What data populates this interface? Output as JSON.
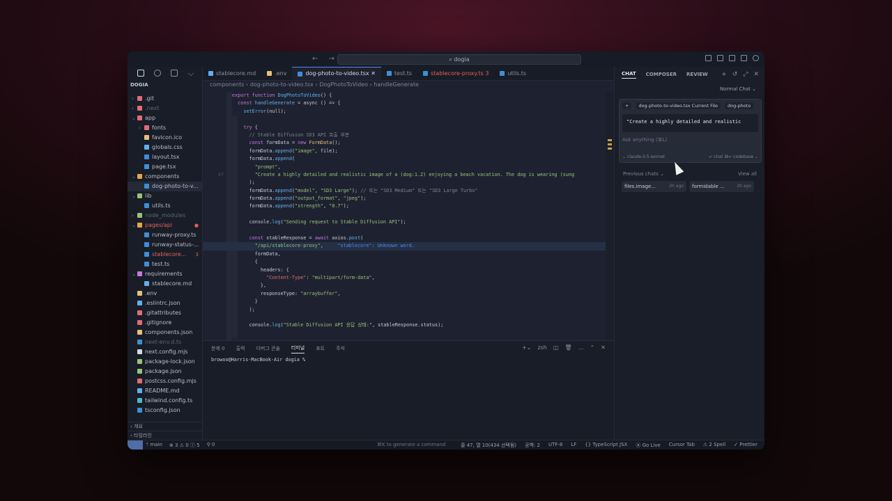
{
  "titlebar": {
    "search": "dogia"
  },
  "sidebar": {
    "project": "DOGIA",
    "tree": [
      {
        "label": ".git",
        "chev": "›",
        "indent": 1,
        "color": "#e06c75",
        "cls": ""
      },
      {
        "label": ".next",
        "chev": "›",
        "indent": 1,
        "color": "#e06c75",
        "cls": "dim"
      },
      {
        "label": "app",
        "chev": "⌄",
        "indent": 1,
        "color": "#e06c75",
        "cls": ""
      },
      {
        "label": "fonts",
        "chev": "›",
        "indent": 2,
        "color": "#e06c75",
        "cls": ""
      },
      {
        "label": "favicon.ico",
        "chev": "",
        "indent": 2,
        "color": "#e5c07b",
        "cls": ""
      },
      {
        "label": "globals.css",
        "chev": "",
        "indent": 2,
        "color": "#61afef",
        "cls": ""
      },
      {
        "label": "layout.tsx",
        "chev": "",
        "indent": 2,
        "color": "#3d8fd6",
        "cls": ""
      },
      {
        "label": "page.tsx",
        "chev": "",
        "indent": 2,
        "color": "#3d8fd6",
        "cls": ""
      },
      {
        "label": "components",
        "chev": "⌄",
        "indent": 1,
        "color": "#e5a54b",
        "cls": ""
      },
      {
        "label": "dog-photo-to-v...",
        "chev": "",
        "indent": 2,
        "color": "#3d8fd6",
        "cls": "sel"
      },
      {
        "label": "lib",
        "chev": "⌄",
        "indent": 1,
        "color": "#98c379",
        "cls": ""
      },
      {
        "label": "utils.ts",
        "chev": "",
        "indent": 2,
        "color": "#3d8fd6",
        "cls": ""
      },
      {
        "label": "node_modules",
        "chev": "›",
        "indent": 1,
        "color": "#98c379",
        "cls": "dim"
      },
      {
        "label": "pages/api",
        "chev": "⌄",
        "indent": 1,
        "color": "#e5a54b",
        "cls": "err",
        "badge": "●"
      },
      {
        "label": "runway-proxy.ts",
        "chev": "",
        "indent": 2,
        "color": "#3d8fd6",
        "cls": ""
      },
      {
        "label": "runway-status-...",
        "chev": "",
        "indent": 2,
        "color": "#3d8fd6",
        "cls": ""
      },
      {
        "label": "stablecore...",
        "chev": "",
        "indent": 2,
        "color": "#3d8fd6",
        "cls": "err",
        "badge": "3"
      },
      {
        "label": "test.ts",
        "chev": "",
        "indent": 2,
        "color": "#3d8fd6",
        "cls": ""
      },
      {
        "label": "requirements",
        "chev": "⌄",
        "indent": 1,
        "color": "#c678dd",
        "cls": ""
      },
      {
        "label": "stablecore.md",
        "chev": "",
        "indent": 2,
        "color": "#61afef",
        "cls": ""
      },
      {
        "label": ".env",
        "chev": "",
        "indent": 1,
        "color": "#e5c07b",
        "cls": ""
      },
      {
        "label": ".eslintrc.json",
        "chev": "",
        "indent": 1,
        "color": "#61afef",
        "cls": ""
      },
      {
        "label": ".gitattributes",
        "chev": "",
        "indent": 1,
        "color": "#e06c75",
        "cls": ""
      },
      {
        "label": ".gitignore",
        "chev": "",
        "indent": 1,
        "color": "#e06c75",
        "cls": ""
      },
      {
        "label": "components.json",
        "chev": "",
        "indent": 1,
        "color": "#e5c07b",
        "cls": ""
      },
      {
        "label": "next-env.d.ts",
        "chev": "",
        "indent": 1,
        "color": "#3d8fd6",
        "cls": "dim"
      },
      {
        "label": "next.config.mjs",
        "chev": "",
        "indent": 1,
        "color": "#d5d9e2",
        "cls": ""
      },
      {
        "label": "package-lock.json",
        "chev": "",
        "indent": 1,
        "color": "#98c379",
        "cls": ""
      },
      {
        "label": "package.json",
        "chev": "",
        "indent": 1,
        "color": "#98c379",
        "cls": ""
      },
      {
        "label": "postcss.config.mjs",
        "chev": "",
        "indent": 1,
        "color": "#e06c75",
        "cls": ""
      },
      {
        "label": "README.md",
        "chev": "",
        "indent": 1,
        "color": "#61afef",
        "cls": ""
      },
      {
        "label": "tailwind.config.ts",
        "chev": "",
        "indent": 1,
        "color": "#56b6c2",
        "cls": ""
      },
      {
        "label": "tsconfig.json",
        "chev": "",
        "indent": 1,
        "color": "#3d8fd6",
        "cls": ""
      }
    ],
    "footer": [
      "› 개요",
      "› 타임라인"
    ]
  },
  "editor": {
    "tabs": [
      {
        "label": "stablecore.md",
        "color": "#61afef",
        "cls": ""
      },
      {
        "label": ".env",
        "color": "#e5c07b",
        "cls": ""
      },
      {
        "label": "dog-photo-to-video.tsx  ✕",
        "color": "#3d8fd6",
        "cls": "active"
      },
      {
        "label": "test.ts",
        "color": "#3d8fd6",
        "cls": ""
      },
      {
        "label": "stablecore-proxy.ts  3",
        "color": "#3d8fd6",
        "cls": "errt"
      },
      {
        "label": "utils.ts",
        "color": "#3d8fd6",
        "cls": ""
      }
    ],
    "breadcrumb": "components  ›  dog-photo-to-video.tsx  ›  DogPhotoToVideo  ›  handleGenerate",
    "lines": [
      {
        "ln": "",
        "hl": false,
        "parts": [
          [
            "export function ",
            "#c678dd"
          ],
          [
            "DogPhotoToVideo",
            "#61afef"
          ],
          [
            "() {",
            "#c9ccd4"
          ]
        ]
      },
      {
        "ln": "",
        "hl": false,
        "parts": [
          [
            "  const ",
            "#c678dd"
          ],
          [
            "handleGenerate",
            "#61afef"
          ],
          [
            " = async () => {",
            "#c9ccd4"
          ]
        ]
      },
      {
        "ln": "",
        "hl": false,
        "parts": [
          [
            "    setError",
            "#61afef"
          ],
          [
            "(null);",
            "#c9ccd4"
          ]
        ]
      },
      {
        "ln": "",
        "hl": false,
        "parts": [
          [
            "",
            "#c9ccd4"
          ]
        ]
      },
      {
        "ln": "",
        "hl": false,
        "parts": [
          [
            "    try ",
            "#c678dd"
          ],
          [
            "{",
            "#c9ccd4"
          ]
        ]
      },
      {
        "ln": "",
        "hl": false,
        "parts": [
          [
            "      // Stable Diffusion SD3 API 호출 부분",
            "#7f848e"
          ]
        ]
      },
      {
        "ln": "",
        "hl": false,
        "parts": [
          [
            "      const ",
            "#c678dd"
          ],
          [
            "formData = ",
            "#c9ccd4"
          ],
          [
            "new ",
            "#c678dd"
          ],
          [
            "FormData",
            "#e5c07b"
          ],
          [
            "();",
            "#c9ccd4"
          ]
        ]
      },
      {
        "ln": "",
        "hl": false,
        "parts": [
          [
            "      formData.",
            "#c9ccd4"
          ],
          [
            "append",
            "#61afef"
          ],
          [
            "(",
            "#c9ccd4"
          ],
          [
            "\"image\"",
            "#98c379"
          ],
          [
            ", file);",
            "#c9ccd4"
          ]
        ]
      },
      {
        "ln": "",
        "hl": false,
        "parts": [
          [
            "      formData.",
            "#c9ccd4"
          ],
          [
            "append",
            "#61afef"
          ],
          [
            "(",
            "#c9ccd4"
          ]
        ]
      },
      {
        "ln": "",
        "hl": false,
        "parts": [
          [
            "        \"prompt\"",
            "#98c379"
          ],
          [
            ",",
            "#c9ccd4"
          ]
        ]
      },
      {
        "ln": "47",
        "hl": false,
        "parts": [
          [
            "        \"Create a highly detailed and realistic image of a (dog:1.2) enjoying a beach vacation. The dog is wearing (sung",
            "#98c379"
          ]
        ]
      },
      {
        "ln": "",
        "hl": false,
        "parts": [
          [
            "      );",
            "#c9ccd4"
          ]
        ]
      },
      {
        "ln": "",
        "hl": false,
        "parts": [
          [
            "      formData.",
            "#c9ccd4"
          ],
          [
            "append",
            "#61afef"
          ],
          [
            "(",
            "#c9ccd4"
          ],
          [
            "\"model\"",
            "#98c379"
          ],
          [
            ", ",
            "#c9ccd4"
          ],
          [
            "\"SD3 Large\"",
            "#98c379"
          ],
          [
            "); ",
            "#c9ccd4"
          ],
          [
            "// 또는 \"SD3 Medium\" 또는 \"SD3 Large Turbo\"",
            "#7f848e"
          ]
        ]
      },
      {
        "ln": "",
        "hl": false,
        "parts": [
          [
            "      formData.",
            "#c9ccd4"
          ],
          [
            "append",
            "#61afef"
          ],
          [
            "(",
            "#c9ccd4"
          ],
          [
            "\"output_format\"",
            "#98c379"
          ],
          [
            ", ",
            "#c9ccd4"
          ],
          [
            "\"jpeg\"",
            "#98c379"
          ],
          [
            ");",
            "#c9ccd4"
          ]
        ]
      },
      {
        "ln": "",
        "hl": false,
        "parts": [
          [
            "      formData.",
            "#c9ccd4"
          ],
          [
            "append",
            "#61afef"
          ],
          [
            "(",
            "#c9ccd4"
          ],
          [
            "\"strength\"",
            "#98c379"
          ],
          [
            ", ",
            "#c9ccd4"
          ],
          [
            "\"0.7\"",
            "#98c379"
          ],
          [
            ");",
            "#c9ccd4"
          ]
        ]
      },
      {
        "ln": "",
        "hl": false,
        "parts": [
          [
            "",
            "#c9ccd4"
          ]
        ]
      },
      {
        "ln": "",
        "hl": false,
        "parts": [
          [
            "      console.",
            "#c9ccd4"
          ],
          [
            "log",
            "#61afef"
          ],
          [
            "(",
            "#c9ccd4"
          ],
          [
            "\"Sending request to Stable Diffusion API\"",
            "#98c379"
          ],
          [
            ");",
            "#c9ccd4"
          ]
        ]
      },
      {
        "ln": "",
        "hl": false,
        "parts": [
          [
            "",
            "#c9ccd4"
          ]
        ]
      },
      {
        "ln": "",
        "hl": false,
        "parts": [
          [
            "      const ",
            "#c678dd"
          ],
          [
            "stableResponse = ",
            "#c9ccd4"
          ],
          [
            "await ",
            "#c678dd"
          ],
          [
            "axios.",
            "#c9ccd4"
          ],
          [
            "post",
            "#61afef"
          ],
          [
            "(",
            "#c9ccd4"
          ]
        ]
      },
      {
        "ln": "",
        "hl": true,
        "parts": [
          [
            "        \"/api/stablecore-proxy\"",
            "#98c379"
          ],
          [
            ",     ",
            "#c9ccd4"
          ],
          [
            "\"stablecore\": Unknown word.",
            "#4f8cf0"
          ]
        ]
      },
      {
        "ln": "",
        "hl": false,
        "parts": [
          [
            "        formData,",
            "#c9ccd4"
          ]
        ]
      },
      {
        "ln": "",
        "hl": false,
        "parts": [
          [
            "        {",
            "#c9ccd4"
          ]
        ]
      },
      {
        "ln": "",
        "hl": false,
        "parts": [
          [
            "          headers: {",
            "#c9ccd4"
          ]
        ]
      },
      {
        "ln": "",
        "hl": false,
        "parts": [
          [
            "            \"Content-Type\"",
            "#e06c75"
          ],
          [
            ": ",
            "#c9ccd4"
          ],
          [
            "\"multipart/form-data\"",
            "#98c379"
          ],
          [
            ",",
            "#c9ccd4"
          ]
        ]
      },
      {
        "ln": "",
        "hl": false,
        "parts": [
          [
            "          },",
            "#c9ccd4"
          ]
        ]
      },
      {
        "ln": "",
        "hl": false,
        "parts": [
          [
            "          responseType: ",
            "#c9ccd4"
          ],
          [
            "\"arraybuffer\"",
            "#98c379"
          ],
          [
            ",",
            "#c9ccd4"
          ]
        ]
      },
      {
        "ln": "",
        "hl": false,
        "parts": [
          [
            "        }",
            "#c9ccd4"
          ]
        ]
      },
      {
        "ln": "",
        "hl": false,
        "parts": [
          [
            "      );",
            "#c9ccd4"
          ]
        ]
      },
      {
        "ln": "",
        "hl": false,
        "parts": [
          [
            "",
            "#c9ccd4"
          ]
        ]
      },
      {
        "ln": "",
        "hl": false,
        "parts": [
          [
            "      console.",
            "#c9ccd4"
          ],
          [
            "log",
            "#61afef"
          ],
          [
            "(",
            "#c9ccd4"
          ],
          [
            "\"Stable Diffusion API 응답 상태:\"",
            "#98c379"
          ],
          [
            ", stableResponse.status);",
            "#c9ccd4"
          ]
        ]
      }
    ]
  },
  "panel": {
    "tabs": [
      "문제  0",
      "출력",
      "디버그 콘솔",
      "터미널",
      "포트",
      "주석"
    ],
    "active": 3,
    "shell": "zsh",
    "prompt": "browoo@Harris-MacBook-Air dogia %"
  },
  "chat": {
    "tabs": [
      "CHAT",
      "COMPOSER",
      "REVIEW"
    ],
    "mode": "Normal Chat ⌄",
    "chips": [
      "+",
      "dog-photo-to-video.tsx  Current File",
      "dog-photo"
    ],
    "prompt": "\"Create a highly detailed and realistic",
    "ask": "Ask anything (⌘L)",
    "model": "⌄ claude-3.5-sonnet",
    "actions": "↵ chat   ⌘↵ codebase ⌄",
    "previous": "Previous chats ⌄",
    "view_all": "View all",
    "history": [
      {
        "label": "files.image...",
        "age": "2h ago"
      },
      {
        "label": "formidable ...",
        "age": "2h ago"
      }
    ]
  },
  "status": {
    "left": [
      "ᛘ main",
      "⊗ 3 ⚠ 0 ⓘ 5",
      "⚲ 0"
    ],
    "mid": "⌘K to generate a command",
    "right": [
      "줄 47, 열 10(434 선택됨)",
      "공백: 2",
      "UTF-8",
      "LF",
      "{} TypeScript JSX",
      "⦿ Go Live",
      "Cursor Tab",
      "⚠ 2 Spell",
      "✓ Prettier"
    ]
  }
}
